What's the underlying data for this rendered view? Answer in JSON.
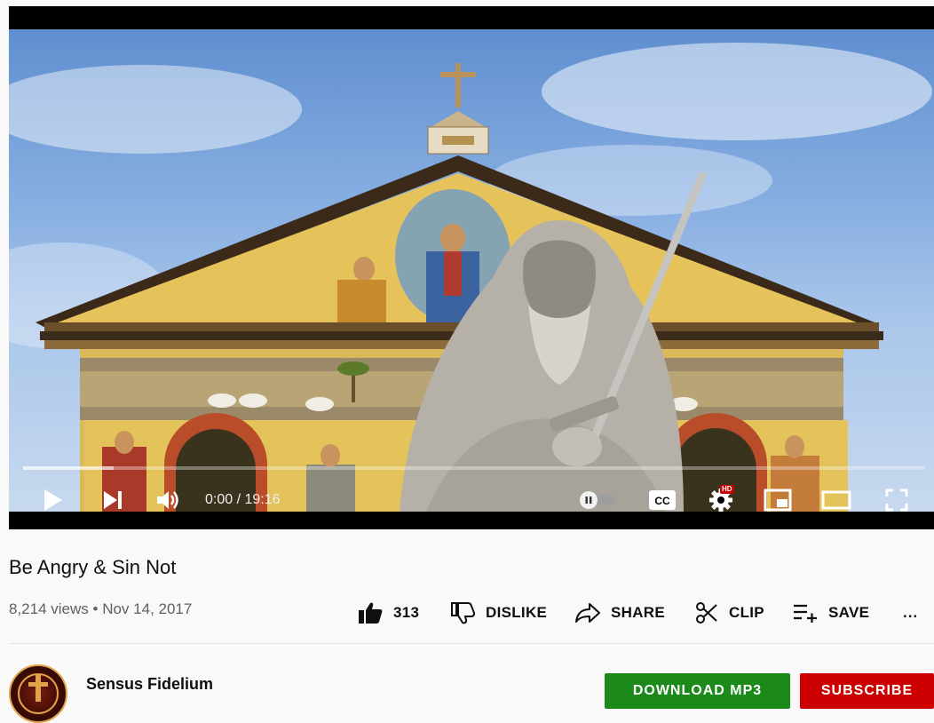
{
  "player": {
    "current_time": "0:00",
    "time_separator": " / ",
    "duration": "19:16",
    "progress_fraction": 0,
    "hd_badge": "HD",
    "cc_label": "CC",
    "icons": [
      "play-icon",
      "next-icon",
      "volume-icon",
      "autoplay-toggle-icon",
      "captions-icon",
      "settings-icon",
      "miniplayer-icon",
      "theater-mode-icon",
      "fullscreen-icon"
    ]
  },
  "video": {
    "title": "Be Angry & Sin Not",
    "views": "8,214 views",
    "separator": "•",
    "date": "Nov 14, 2017"
  },
  "actions": {
    "like_count": "313",
    "dislike_label": "DISLIKE",
    "share_label": "SHARE",
    "clip_label": "CLIP",
    "save_label": "SAVE",
    "more_label": "..."
  },
  "channel": {
    "name": "Sensus Fidelium",
    "download_label": "DOWNLOAD MP3",
    "subscribe_label": "SUBSCRIBE"
  },
  "colors": {
    "accent_red": "#cc0000",
    "download_green": "#1b8a1b",
    "progress_red": "#ff0000"
  }
}
